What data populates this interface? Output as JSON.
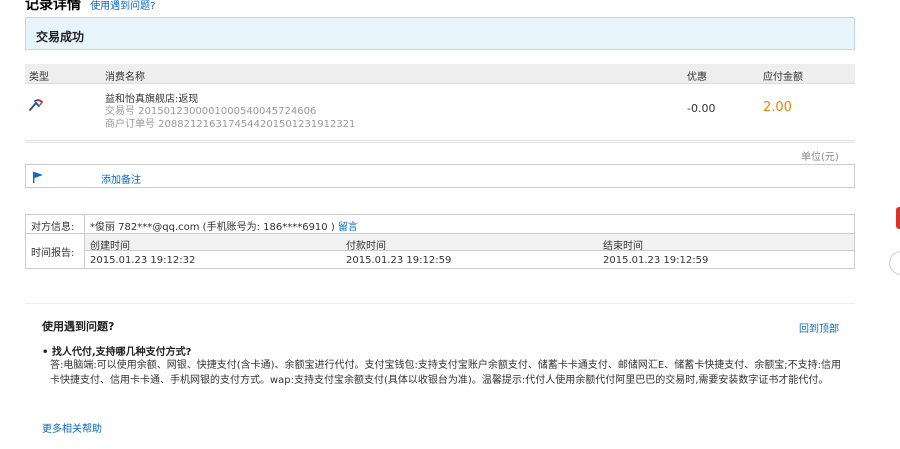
{
  "page": {
    "title": "记录详情",
    "help_link": "使用遇到问题?"
  },
  "status": {
    "text": "交易成功"
  },
  "transaction_table": {
    "headers": {
      "type": "类型",
      "name": "消费名称",
      "discount": "优惠",
      "amount": "应付金额"
    },
    "row": {
      "name": "益和怡真旗舰店:返现",
      "trade_no": "交易号 2015012300001000540045724606",
      "merchant_order_no": "商户订单号 2088212163174544201501231912321",
      "discount": "-0.00",
      "amount": "2.00"
    },
    "unit": "单位(元)"
  },
  "remark": {
    "add_label": "添加备注"
  },
  "info": {
    "counterparty_label": "对方信息:",
    "counterparty_value": "*俊丽 782***@qq.com (手机账号为: 186****6910 )",
    "message_link": "留言",
    "time_label": "时间报告:",
    "created_label": "创建时间",
    "paid_label": "付款时间",
    "ended_label": "结束时间",
    "created_value": "2015.01.23 19:12:32",
    "paid_value": "2015.01.23 19:12:59",
    "ended_value": "2015.01.23 19:12:59"
  },
  "faq": {
    "title": "使用遇到问题?",
    "back_to_top": "回到顶部",
    "question": "• 找人代付,支持哪几种支付方式?",
    "answer": "答:电脑端:可以使用余额、网银、快捷支付(含卡通)、余额宝进行代付。支付宝钱包:支持支付宝账户余额支付、储蓄卡卡通支付、邮储网汇E、储蓄卡快捷支付、余额宝;不支持:信用卡快捷支付、信用卡卡通、手机网银的支付方式。wap:支持支付宝余额支付(具体以收银台为准)。温馨提示:代付人使用余额代付阿里巴巴的交易时,需要安装数字证书才能代付。",
    "more_help": "更多相关帮助"
  },
  "colors": {
    "link": "#0a68c4",
    "amount": "#f08200",
    "status_bg": "#e8f4fc"
  }
}
